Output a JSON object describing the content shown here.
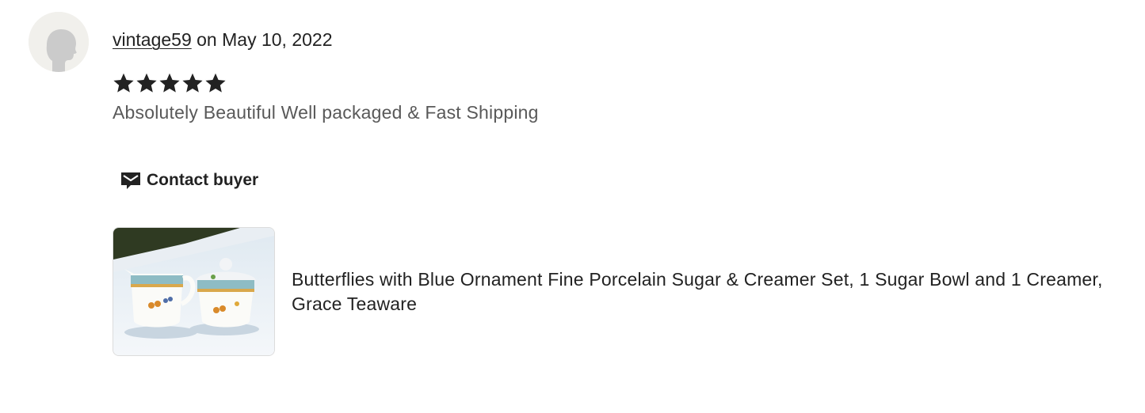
{
  "review": {
    "username": "vintage59",
    "date_text": "on May 10, 2022",
    "rating": 5,
    "rating_max": 5,
    "text": "Absolutely Beautiful Well packaged & Fast Shipping"
  },
  "contact": {
    "label": "Contact buyer",
    "icon": "envelope-icon"
  },
  "product": {
    "title": "Butterflies with Blue Ornament Fine Porcelain Sugar & Creamer Set, 1 Sugar Bowl and 1 Creamer, Grace Teaware"
  },
  "colors": {
    "text": "#222222",
    "muted_text": "#595959",
    "avatar_bg": "#f1f0ec",
    "star": "#222222"
  }
}
